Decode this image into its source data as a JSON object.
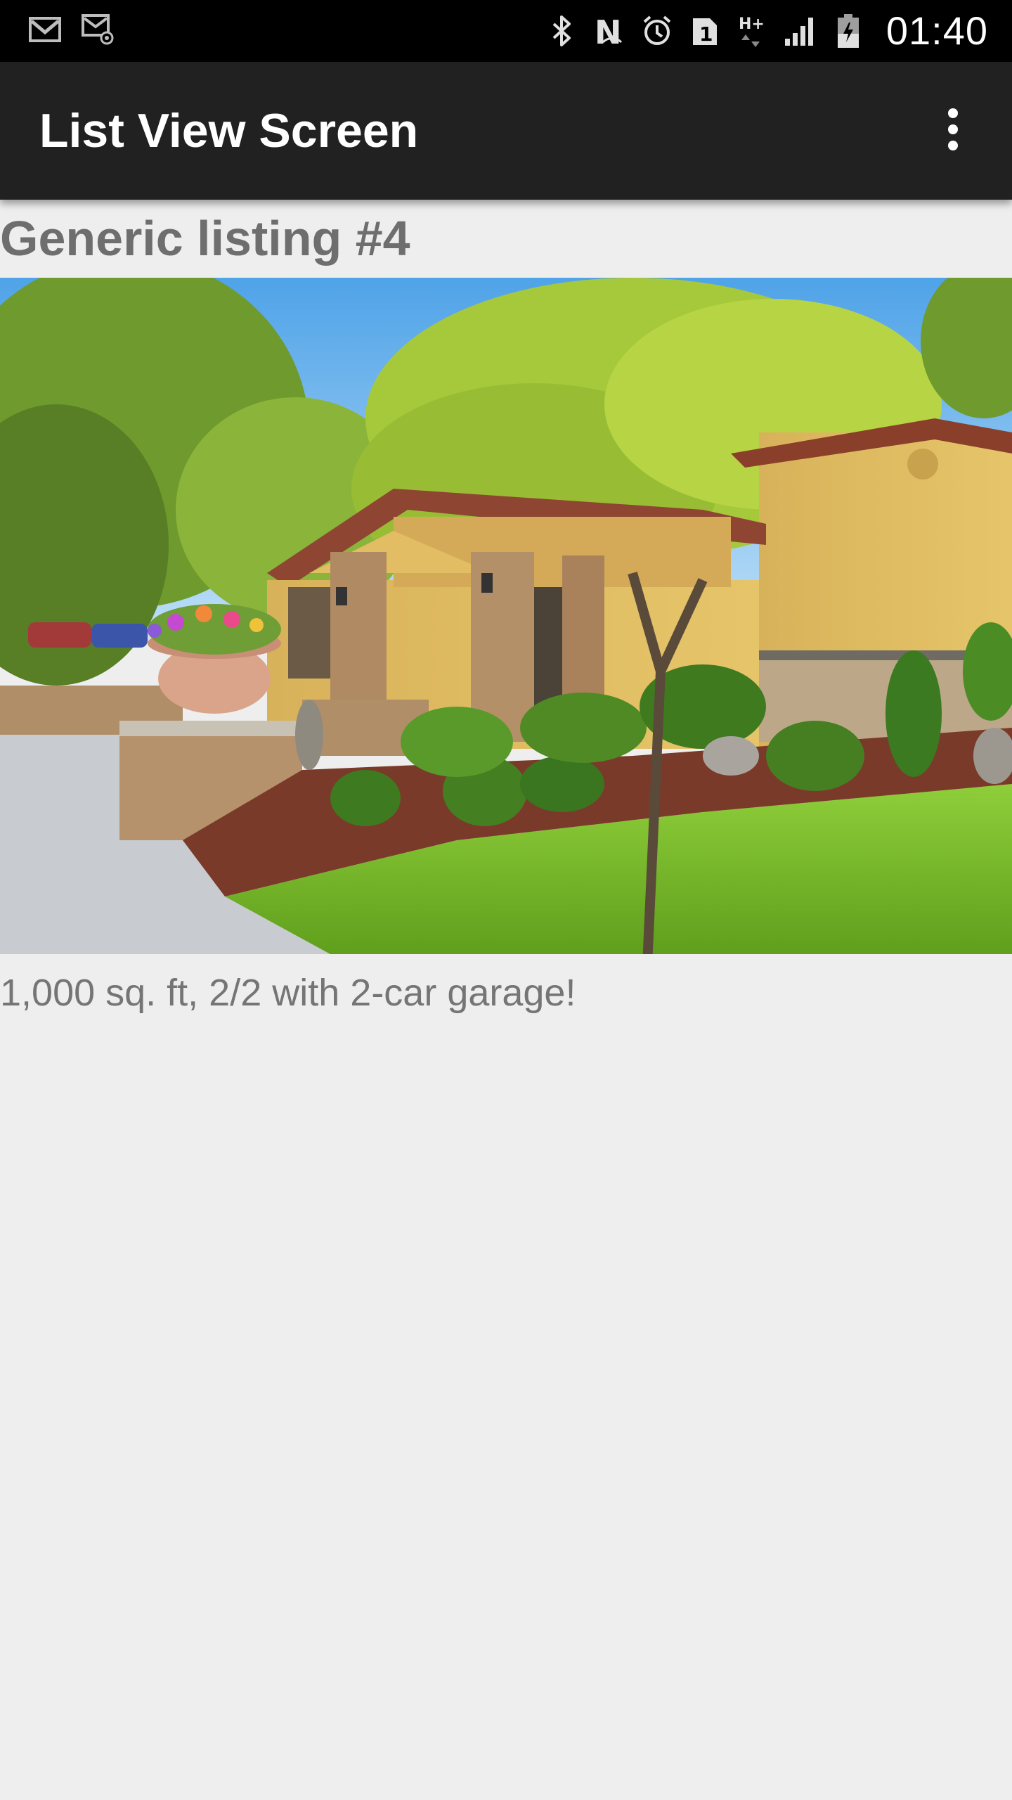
{
  "status_bar": {
    "time": "01:40",
    "left_icons": [
      "gmail-icon",
      "email-image-icon"
    ],
    "right_icons": [
      "bluetooth-icon",
      "nfc-icon",
      "alarm-icon",
      "sim-1-icon",
      "hplus-data-icon",
      "signal-icon",
      "battery-icon"
    ],
    "network_label": "H+",
    "sim_label": "1",
    "nfc_label": "N"
  },
  "app_bar": {
    "title": "List View Screen",
    "menu_icon": "more-vert-icon"
  },
  "listing": {
    "title": "Generic listing #4",
    "photo_icon": "house-photo",
    "description": "1,000 sq. ft, 2/2 with 2-car garage!"
  },
  "colors": {
    "status_bar_bg": "#000000",
    "app_bar_bg": "#212121",
    "page_bg": "#eeeeee",
    "title_text": "#6e6e6e",
    "description_text": "#757575"
  }
}
